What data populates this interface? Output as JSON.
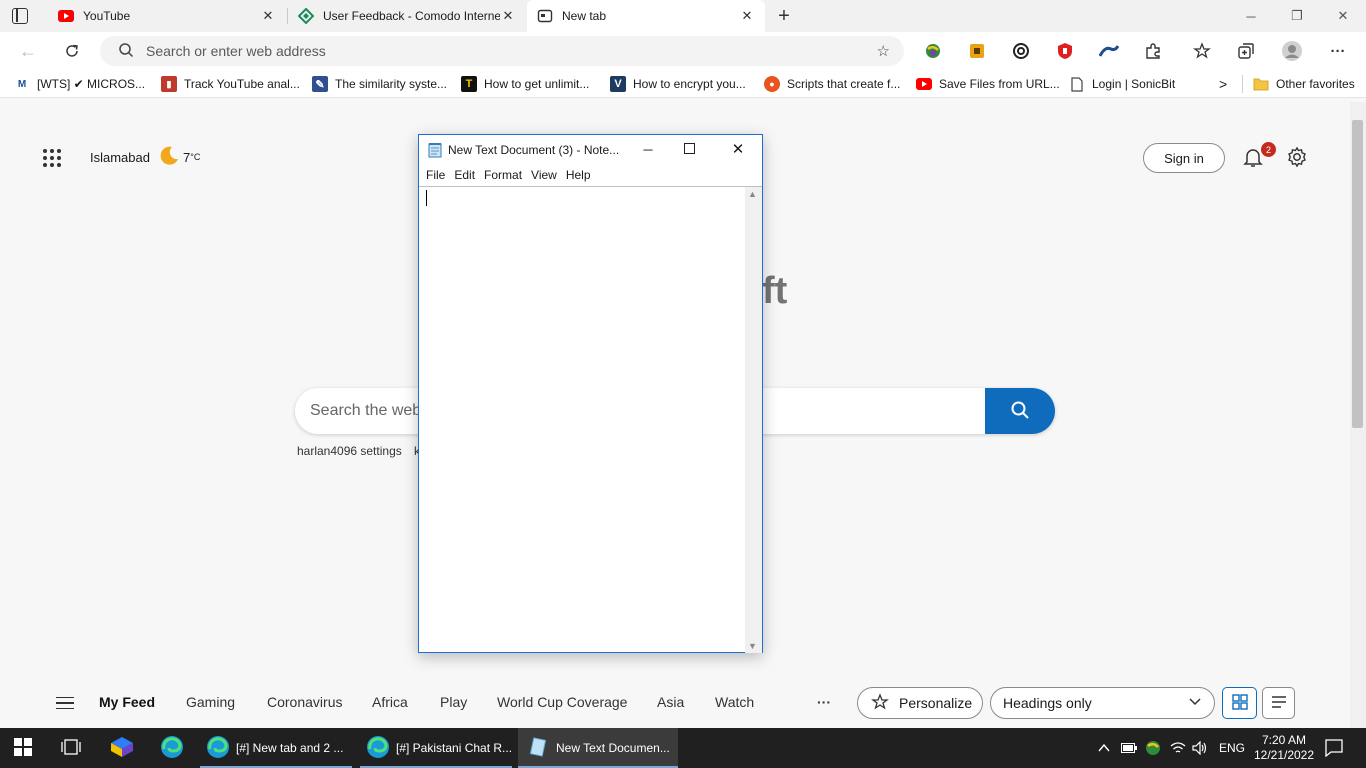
{
  "tabs": [
    {
      "title": "YouTube",
      "icon": "youtube-icon"
    },
    {
      "title": "User Feedback - Comodo Interne",
      "icon": "comodo-icon"
    },
    {
      "title": "New tab",
      "icon": "new-tab-icon",
      "active": true
    }
  ],
  "window_controls": {
    "minimize": "─",
    "restore": "❐",
    "close": "✕"
  },
  "address_bar": {
    "placeholder": "Search or enter web address"
  },
  "favorites": [
    {
      "label": "[WTS] ✔ MICROS...",
      "icon_text": "M",
      "color": "#1b4f9c"
    },
    {
      "label": "Track YouTube anal...",
      "icon_text": "▮",
      "color": "#c0392b"
    },
    {
      "label": "The similarity syste...",
      "icon_text": "✎",
      "color": "#2f4f8f"
    },
    {
      "label": "How to get unlimit...",
      "icon_text": "T",
      "color": "#111111"
    },
    {
      "label": "How to encrypt you...",
      "icon_text": "V",
      "color": "#1e3a5f"
    },
    {
      "label": "Scripts that create f...",
      "icon_text": "●",
      "color": "#e8531e"
    },
    {
      "label": "Save Files from URL...",
      "icon_text": "▶",
      "color": "#e52d27"
    },
    {
      "label": "Login | SonicBit",
      "icon_text": "□",
      "color": "#555555"
    }
  ],
  "favorites_more": ">",
  "other_favorites": "Other favorites",
  "weather": {
    "city": "Islamabad",
    "temp": "7",
    "unit": "°C"
  },
  "header_actions": {
    "sign_in": "Sign in",
    "notification_count": "2"
  },
  "logo_fragment": "ft",
  "search": {
    "placeholder": "Search the web"
  },
  "quick_links": [
    "harlan4096 settings",
    "k"
  ],
  "notepad": {
    "title": "New Text Document (3) - Note...",
    "menu": [
      "File",
      "Edit",
      "Format",
      "View",
      "Help"
    ],
    "content": ""
  },
  "feed": {
    "items": [
      "My Feed",
      "Gaming",
      "Coronavirus",
      "Africa",
      "Play",
      "World Cup Coverage",
      "Asia",
      "Watch"
    ],
    "more": "···",
    "personalize": "Personalize",
    "layout_select": "Headings only"
  },
  "taskbar": {
    "items": [
      {
        "label": "[#] New tab and 2 ...",
        "icon": "edge-icon"
      },
      {
        "label": "[#] Pakistani Chat R...",
        "icon": "edge-icon"
      },
      {
        "label": "New Text Documen...",
        "icon": "notepad-icon",
        "active": true
      }
    ],
    "language": "ENG",
    "time": "7:20 AM",
    "date": "12/21/2022"
  },
  "colors": {
    "accent": "#0f6cbd",
    "taskbar": "#202020",
    "badge": "#c42b1c"
  }
}
